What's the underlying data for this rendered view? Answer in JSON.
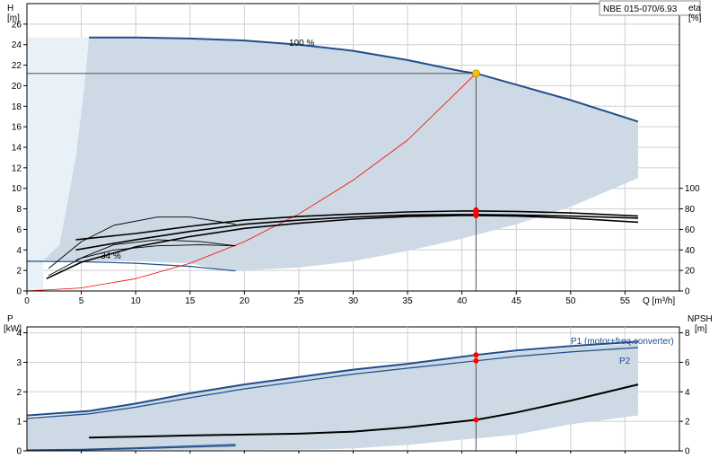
{
  "model_label": "NBE 015-070/6.93",
  "colors": {
    "envelope": "#cdd9e4",
    "envelope_light": "#e8f0f8",
    "pump_curve": "#1f4e8c",
    "efficiency": "#000000",
    "system_curve": "#ff0000",
    "duty_point": "#f5c400",
    "marker": "#ff0000",
    "crosshair": "#555555"
  },
  "chart_data": [
    {
      "type": "line",
      "id": "upper",
      "xlabel": "Q [m³/h]",
      "y_left_label": "H",
      "y_left_unit": "[m]",
      "y_right_label": "eta",
      "y_right_unit": "[%]",
      "xlim": [
        0,
        60
      ],
      "ylim": [
        0,
        28
      ],
      "x_ticks": [
        0,
        5,
        10,
        15,
        20,
        25,
        30,
        35,
        40,
        45,
        50,
        55
      ],
      "y_ticks": [
        0,
        2,
        4,
        6,
        8,
        10,
        12,
        14,
        16,
        18,
        20,
        22,
        24,
        26
      ],
      "eta_ticks": [
        0,
        20,
        40,
        60,
        80,
        100
      ],
      "eta_max_at_y": 10,
      "annotations": [
        {
          "text": "100 %",
          "x": 26,
          "y": 25.1
        },
        {
          "text": "34 %",
          "x": 8,
          "y": 3.6
        }
      ],
      "duty_point": {
        "x": 41.3,
        "y": 21.2
      },
      "envelope_outer": [
        [
          1.5,
          0
        ],
        [
          1.5,
          3
        ],
        [
          3,
          4.5
        ],
        [
          4.5,
          13
        ],
        [
          5.3,
          20
        ],
        [
          5.7,
          24.7
        ],
        [
          10,
          24.7
        ],
        [
          15,
          24.6
        ],
        [
          20,
          24.4
        ],
        [
          25,
          24.0
        ],
        [
          30,
          23.4
        ],
        [
          35,
          22.5
        ],
        [
          40,
          21.4
        ],
        [
          45,
          20.1
        ],
        [
          50,
          18.6
        ],
        [
          56.2,
          16.5
        ],
        [
          56.2,
          11
        ],
        [
          50,
          8.2
        ],
        [
          45,
          6.5
        ],
        [
          40,
          5.1
        ],
        [
          35,
          3.9
        ],
        [
          30,
          2.9
        ],
        [
          25,
          2.3
        ],
        [
          20,
          2.0
        ],
        [
          18,
          2.0
        ],
        [
          15,
          2.7
        ],
        [
          10,
          2.9
        ],
        [
          5,
          2.9
        ],
        [
          1.5,
          3
        ]
      ],
      "envelope_light_left": [
        [
          0,
          0
        ],
        [
          0,
          24.7
        ],
        [
          5.7,
          24.7
        ],
        [
          5.3,
          20
        ],
        [
          4.5,
          13
        ],
        [
          3,
          4.5
        ],
        [
          1.5,
          3
        ],
        [
          1.5,
          0
        ]
      ],
      "series": [
        {
          "name": "100 %",
          "role": "pump",
          "x": [
            5.7,
            10,
            15,
            20,
            25,
            30,
            35,
            40,
            41.3,
            45,
            50,
            56.2
          ],
          "y": [
            24.7,
            24.7,
            24.6,
            24.4,
            24.0,
            23.4,
            22.5,
            21.4,
            21.2,
            20.1,
            18.6,
            16.5
          ]
        },
        {
          "name": "34 %",
          "role": "pump_min",
          "x": [
            0,
            5,
            10,
            15,
            19.2
          ],
          "y": [
            2.9,
            2.85,
            2.7,
            2.4,
            1.95
          ]
        },
        {
          "name": "",
          "role": "system",
          "x": [
            0,
            5,
            10,
            15,
            20,
            25,
            30,
            35,
            41.3
          ],
          "y": [
            0,
            0.3,
            1.2,
            2.7,
            4.8,
            7.5,
            10.8,
            14.7,
            21.2
          ]
        },
        {
          "name": "",
          "role": "eta",
          "x": [
            1.8,
            5,
            10,
            15,
            20,
            25,
            30,
            35,
            40,
            41.3,
            45,
            50,
            56.2
          ],
          "eta": [
            12,
            28,
            43,
            53,
            61,
            66,
            70,
            72.5,
            73.5,
            73.5,
            73,
            71,
            67
          ]
        },
        {
          "name": "",
          "role": "eta",
          "x": [
            4.5,
            10,
            15,
            20,
            25,
            30,
            35,
            40,
            41.3,
            45,
            50,
            56.2
          ],
          "eta": [
            40,
            50,
            58,
            65,
            69,
            72,
            74,
            74.5,
            74.5,
            74,
            73,
            71
          ]
        },
        {
          "name": "",
          "role": "eta",
          "x": [
            4.5,
            10,
            15,
            20,
            25,
            30,
            35,
            40,
            41.3,
            45,
            50,
            56.2
          ],
          "eta": [
            50,
            56,
            63,
            69,
            72.5,
            75,
            77,
            78,
            78,
            77.5,
            76,
            73
          ]
        },
        {
          "name": "",
          "role": "eta_small",
          "x": [
            4.5,
            8,
            12,
            16,
            19.2
          ],
          "eta": [
            30,
            45,
            50,
            48,
            44
          ]
        },
        {
          "name": "",
          "role": "eta_small",
          "x": [
            2,
            5,
            8,
            12,
            16,
            19.2
          ],
          "eta": [
            15,
            32,
            40,
            44,
            45,
            44
          ]
        },
        {
          "name": "",
          "role": "eta_small",
          "x": [
            2,
            5,
            8,
            12,
            15,
            19.2
          ],
          "eta": [
            22,
            48,
            64,
            72,
            72,
            65
          ]
        }
      ],
      "markers_eta": [
        73.5,
        76,
        79
      ],
      "crosshair_x": 41.3,
      "crosshair_y": 21.2
    },
    {
      "type": "line",
      "id": "lower",
      "xlabel": "",
      "y_left_label": "P",
      "y_left_unit": "[kW]",
      "y_right_label": "NPSH",
      "y_right_unit": "[m]",
      "xlim": [
        0,
        60
      ],
      "ylim": [
        0,
        4.2
      ],
      "y_ticks": [
        0,
        1,
        2,
        3,
        4
      ],
      "npsh_ticks": [
        0,
        2,
        4,
        6,
        8
      ],
      "npsh_max_at_y": 4,
      "envelope": [
        [
          0,
          1.1
        ],
        [
          5.7,
          1.35
        ],
        [
          10,
          1.6
        ],
        [
          15,
          1.95
        ],
        [
          20,
          2.25
        ],
        [
          25,
          2.5
        ],
        [
          30,
          2.75
        ],
        [
          35,
          2.95
        ],
        [
          40,
          3.15
        ],
        [
          45,
          3.35
        ],
        [
          50,
          3.5
        ],
        [
          56.2,
          3.65
        ],
        [
          56.2,
          1.2
        ],
        [
          50,
          0.9
        ],
        [
          45,
          0.55
        ],
        [
          41.3,
          0.42
        ],
        [
          40,
          0.38
        ],
        [
          35,
          0.2
        ],
        [
          30,
          0.08
        ],
        [
          27,
          0.05
        ],
        [
          20,
          0.03
        ],
        [
          10,
          0.02
        ],
        [
          0,
          0.02
        ]
      ],
      "series": [
        {
          "name": "P1 (motor+freq.converter)",
          "role": "p1",
          "x": [
            0,
            5.7,
            10,
            15,
            20,
            25,
            30,
            35,
            41.3,
            45,
            50,
            56.2
          ],
          "y": [
            1.2,
            1.35,
            1.6,
            1.95,
            2.25,
            2.5,
            2.75,
            2.95,
            3.25,
            3.4,
            3.55,
            3.7
          ]
        },
        {
          "name": "P2",
          "role": "p2",
          "x": [
            0,
            5.7,
            10,
            15,
            20,
            25,
            30,
            35,
            41.3,
            45,
            50,
            56.2
          ],
          "y": [
            1.1,
            1.25,
            1.48,
            1.8,
            2.1,
            2.35,
            2.6,
            2.8,
            3.05,
            3.2,
            3.35,
            3.5
          ]
        },
        {
          "name": "",
          "role": "npsh",
          "x": [
            5.7,
            10,
            15,
            20,
            25,
            30,
            35,
            41.3,
            45,
            50,
            56.2
          ],
          "y": [
            0.45,
            0.48,
            0.52,
            0.55,
            0.58,
            0.65,
            0.8,
            1.05,
            1.3,
            1.7,
            2.25
          ]
        },
        {
          "name": "",
          "role": "small_p",
          "x": [
            0,
            5,
            10,
            19.2
          ],
          "y": [
            0.03,
            0.05,
            0.1,
            0.22
          ]
        },
        {
          "name": "",
          "role": "small_p",
          "x": [
            0,
            5,
            10,
            19.2
          ],
          "y": [
            0.01,
            0.03,
            0.07,
            0.17
          ]
        }
      ],
      "markers": [
        3.25,
        3.05
      ],
      "npsh_marker": 1.05,
      "crosshair_x": 41.3
    }
  ]
}
